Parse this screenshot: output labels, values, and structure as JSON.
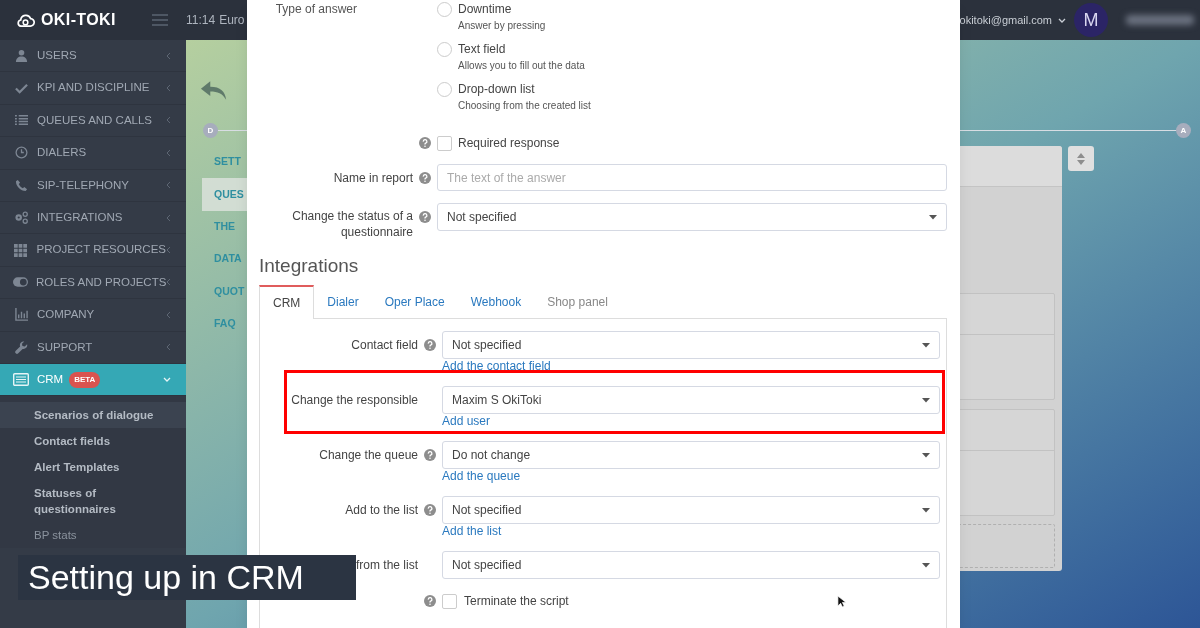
{
  "header": {
    "logo": "OKI-TOKI",
    "time": "11:14",
    "timezone": "Euro",
    "email": "okitoki@gmail.com",
    "avatar": "M"
  },
  "sidebar": {
    "items": [
      {
        "label": "USERS",
        "selected": false,
        "expanded": false
      },
      {
        "label": "KPI AND DISCIPLINE",
        "selected": false,
        "expanded": false
      },
      {
        "label": "QUEUES AND CALLS",
        "selected": false,
        "expanded": false
      },
      {
        "label": "DIALERS",
        "selected": false,
        "expanded": false
      },
      {
        "label": "SIP-TELEPHONY",
        "selected": false,
        "expanded": false
      },
      {
        "label": "INTEGRATIONS",
        "selected": false,
        "expanded": false
      },
      {
        "label": "PROJECT RESOURCES",
        "selected": false,
        "expanded": false
      },
      {
        "label": "ROLES AND PROJECTS",
        "selected": false,
        "expanded": false
      },
      {
        "label": "COMPANY",
        "selected": false,
        "expanded": false
      },
      {
        "label": "SUPPORT",
        "selected": false,
        "expanded": false
      },
      {
        "label": "CRM",
        "badge": "BETA",
        "selected": true,
        "expanded": true,
        "children": [
          {
            "label": "Scenarios of dialogue",
            "selected": true,
            "disabled": false
          },
          {
            "label": "Contact fields",
            "selected": false,
            "disabled": false
          },
          {
            "label": "Alert Templates",
            "selected": false,
            "disabled": false
          },
          {
            "label": "Statuses of questionnaires",
            "selected": false,
            "disabled": false
          },
          {
            "label": "BP stats",
            "selected": false,
            "disabled": true
          }
        ]
      }
    ]
  },
  "background_page": {
    "steps": [
      "D",
      "A"
    ],
    "nav": [
      {
        "label": "SETT",
        "selected": false
      },
      {
        "label": "QUES",
        "selected": true
      },
      {
        "label": "THE",
        "selected": false
      },
      {
        "label": "DATA",
        "selected": false
      },
      {
        "label": "QUOT",
        "selected": false
      },
      {
        "label": "FAQ",
        "selected": false
      }
    ]
  },
  "dialog": {
    "answer_type": {
      "label": "Type of answer",
      "options": [
        {
          "label": "Downtime",
          "hint": "Answer by pressing",
          "selected": false
        },
        {
          "label": "Text field",
          "hint": "Allows you to fill out the data",
          "selected": false
        },
        {
          "label": "Drop-down list",
          "hint": "Choosing from the created list",
          "selected": false
        }
      ]
    },
    "required_response": {
      "label": "Required response",
      "checked": false
    },
    "name_in_report": {
      "label": "Name in report",
      "placeholder": "The text of the answer"
    },
    "status": {
      "label": "Change the status of a questionnaire",
      "value": "Not specified"
    },
    "integrations": {
      "title": "Integrations",
      "tabs": [
        {
          "label": "CRM",
          "selected": true,
          "disabled": false
        },
        {
          "label": "Dialer",
          "selected": false,
          "disabled": false
        },
        {
          "label": "Oper Place",
          "selected": false,
          "disabled": false
        },
        {
          "label": "Webhook",
          "selected": false,
          "disabled": false
        },
        {
          "label": "Shop panel",
          "selected": false,
          "disabled": true
        }
      ],
      "fields": [
        {
          "label": "Contact field",
          "help": true,
          "value": "Not specified",
          "link": "Add the contact field",
          "highlighted": false
        },
        {
          "label": "Change the responsible",
          "help": false,
          "value": "Maxim S OkiToki",
          "link": "Add user",
          "highlighted": true
        },
        {
          "label": "Change the queue",
          "help": true,
          "value": "Do not change",
          "link": "Add the queue",
          "highlighted": false
        },
        {
          "label": "Add to the list",
          "help": true,
          "value": "Not specified",
          "link": "Add the list",
          "highlighted": false
        },
        {
          "label": "from the list",
          "help": false,
          "value": "Not specified",
          "highlighted": false
        }
      ],
      "terminate": {
        "label": "Terminate the script",
        "checked": false
      }
    }
  },
  "caption": "Setting up in CRM"
}
